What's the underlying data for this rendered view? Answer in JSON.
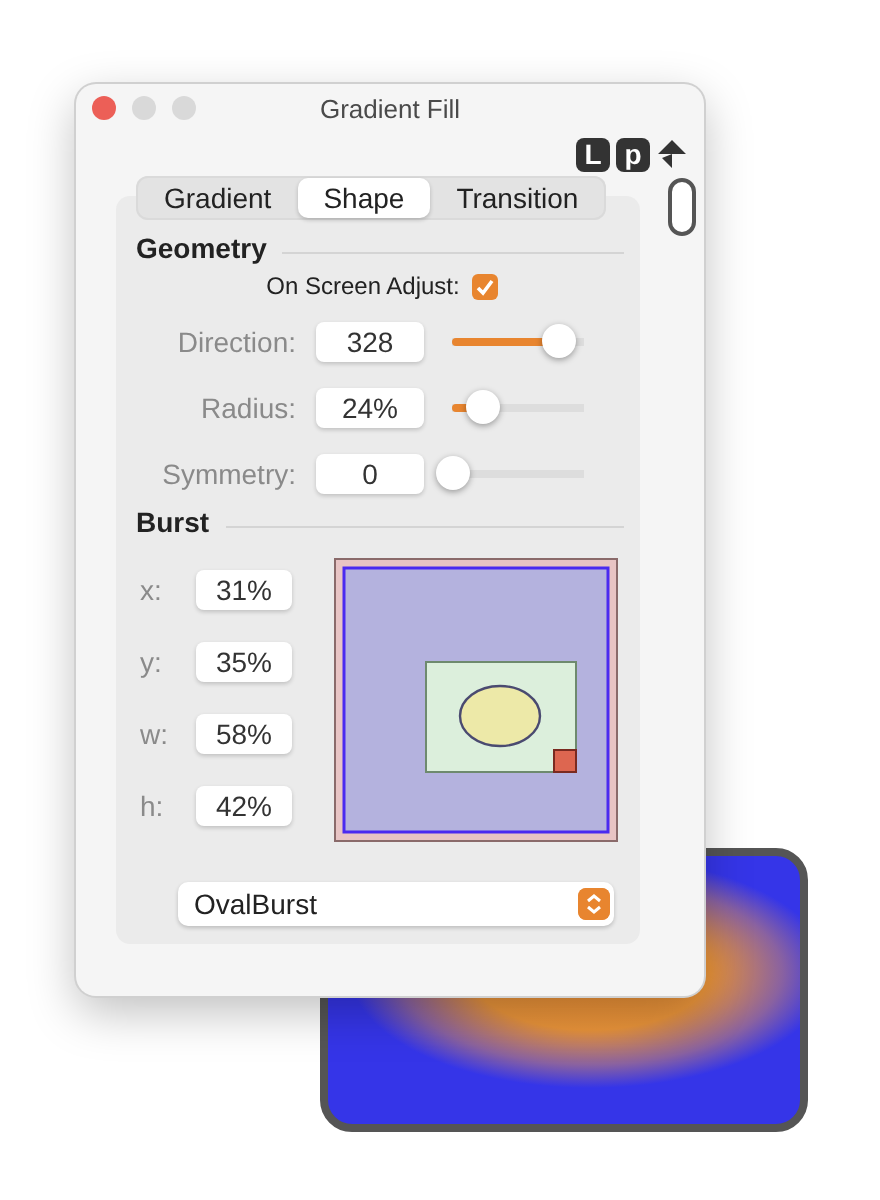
{
  "window": {
    "title": "Gradient Fill"
  },
  "toolbar": {
    "buttons": [
      {
        "label": "L"
      },
      {
        "label": "p"
      }
    ]
  },
  "tabs": [
    {
      "label": "Gradient",
      "selected": false
    },
    {
      "label": "Shape",
      "selected": true
    },
    {
      "label": "Transition",
      "selected": false
    }
  ],
  "geometry": {
    "heading": "Geometry",
    "on_screen_adjust": {
      "label": "On Screen Adjust:",
      "checked": true
    },
    "sliders": [
      {
        "label": "Direction:",
        "value": "328",
        "level": 0.8
      },
      {
        "label": "Radius:",
        "value": "24%",
        "level": 0.23
      },
      {
        "label": "Symmetry:",
        "value": "0",
        "level": 0
      }
    ]
  },
  "burst": {
    "heading": "Burst",
    "fields": [
      {
        "label": "x:",
        "value": "31%"
      },
      {
        "label": "y:",
        "value": "35%"
      },
      {
        "label": "w:",
        "value": "58%"
      },
      {
        "label": "h:",
        "value": "42%"
      }
    ],
    "shape_menu": {
      "value": "OvalBurst"
    }
  }
}
